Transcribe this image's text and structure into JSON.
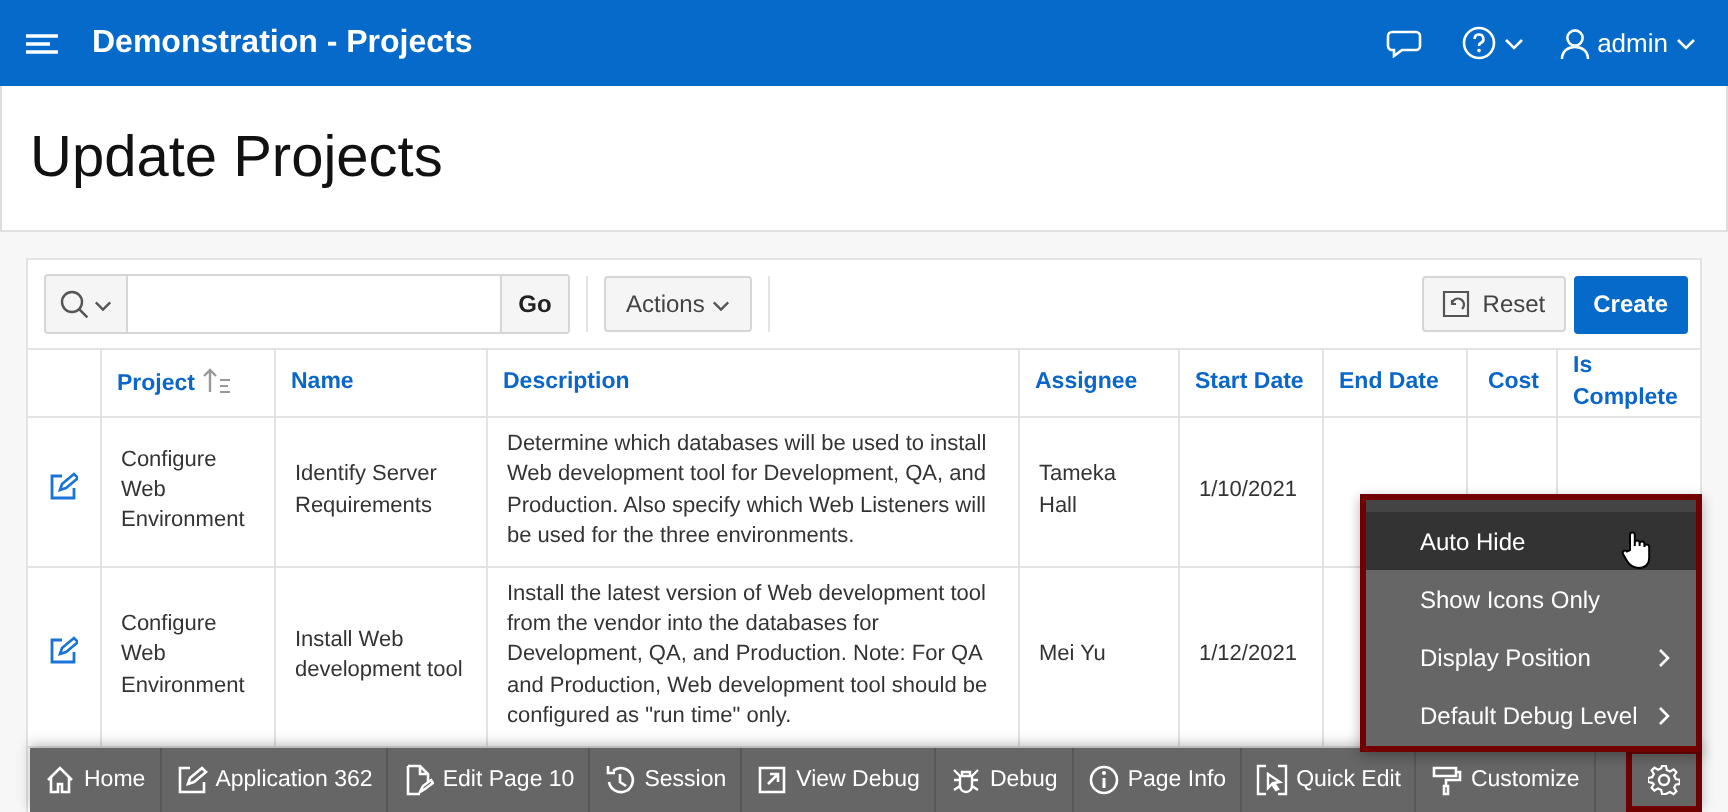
{
  "header": {
    "title": "Demonstration - Projects",
    "user": "admin"
  },
  "page_title": "Update Projects",
  "toolbar": {
    "go": "Go",
    "actions": "Actions",
    "reset": "Reset",
    "create": "Create"
  },
  "table": {
    "columns": [
      {
        "label": "Project",
        "sorted": true,
        "kind": "text"
      },
      {
        "label": "Name",
        "sorted": false,
        "kind": "text"
      },
      {
        "label": "Description",
        "sorted": false,
        "kind": "text"
      },
      {
        "label": "Assignee",
        "sorted": false,
        "kind": "text"
      },
      {
        "label": "Start Date",
        "sorted": false,
        "kind": "text"
      },
      {
        "label": "End Date",
        "sorted": false,
        "kind": "text"
      },
      {
        "label": "Cost",
        "sorted": false,
        "kind": "number"
      },
      {
        "label": "Is Complete",
        "sorted": false,
        "kind": "text"
      }
    ],
    "rows": [
      {
        "cells": [
          "Configure Web Environment",
          "Identify Server Requirements",
          "Determine which databases will be used to install Web development tool for Development, QA, and Production. Also specify which Web Listeners will be used for the three environments.",
          "Tameka Hall",
          "1/10/2021"
        ]
      },
      {
        "cells": [
          "Configure Web Environment",
          "Install Web development tool",
          "Install the latest version of Web development tool from the vendor into the databases for Development, QA, and Production. Note: For QA and Production, Web development tool should be configured as \"run time\" only.",
          "Mei Yu",
          "1/12/2021"
        ]
      }
    ]
  },
  "dev_toolbar": {
    "items": [
      {
        "kind": "home",
        "label": "Home",
        "highlighted": false
      },
      {
        "kind": "edit",
        "label": "Application 362",
        "highlighted": false
      },
      {
        "kind": "page",
        "label": "Edit Page 10",
        "highlighted": false
      },
      {
        "kind": "session",
        "label": "Session",
        "highlighted": false
      },
      {
        "kind": "view",
        "label": "View Debug",
        "highlighted": false
      },
      {
        "kind": "bug",
        "label": "Debug",
        "highlighted": false
      },
      {
        "kind": "info",
        "label": "Page Info",
        "highlighted": false
      },
      {
        "kind": "quick",
        "label": "Quick Edit",
        "highlighted": false
      },
      {
        "kind": "roller",
        "label": "Customize",
        "highlighted": false
      },
      {
        "kind": "settings",
        "highlighted": true
      }
    ]
  },
  "settings_menu": {
    "highlighted": true,
    "items": [
      {
        "label": "Auto Hide",
        "hovered": true,
        "submenu": false
      },
      {
        "label": "Show Icons Only",
        "hovered": false,
        "submenu": false
      },
      {
        "label": "Display Position",
        "hovered": false,
        "submenu": true
      },
      {
        "label": "Default Debug Level",
        "hovered": false,
        "submenu": true
      }
    ]
  }
}
